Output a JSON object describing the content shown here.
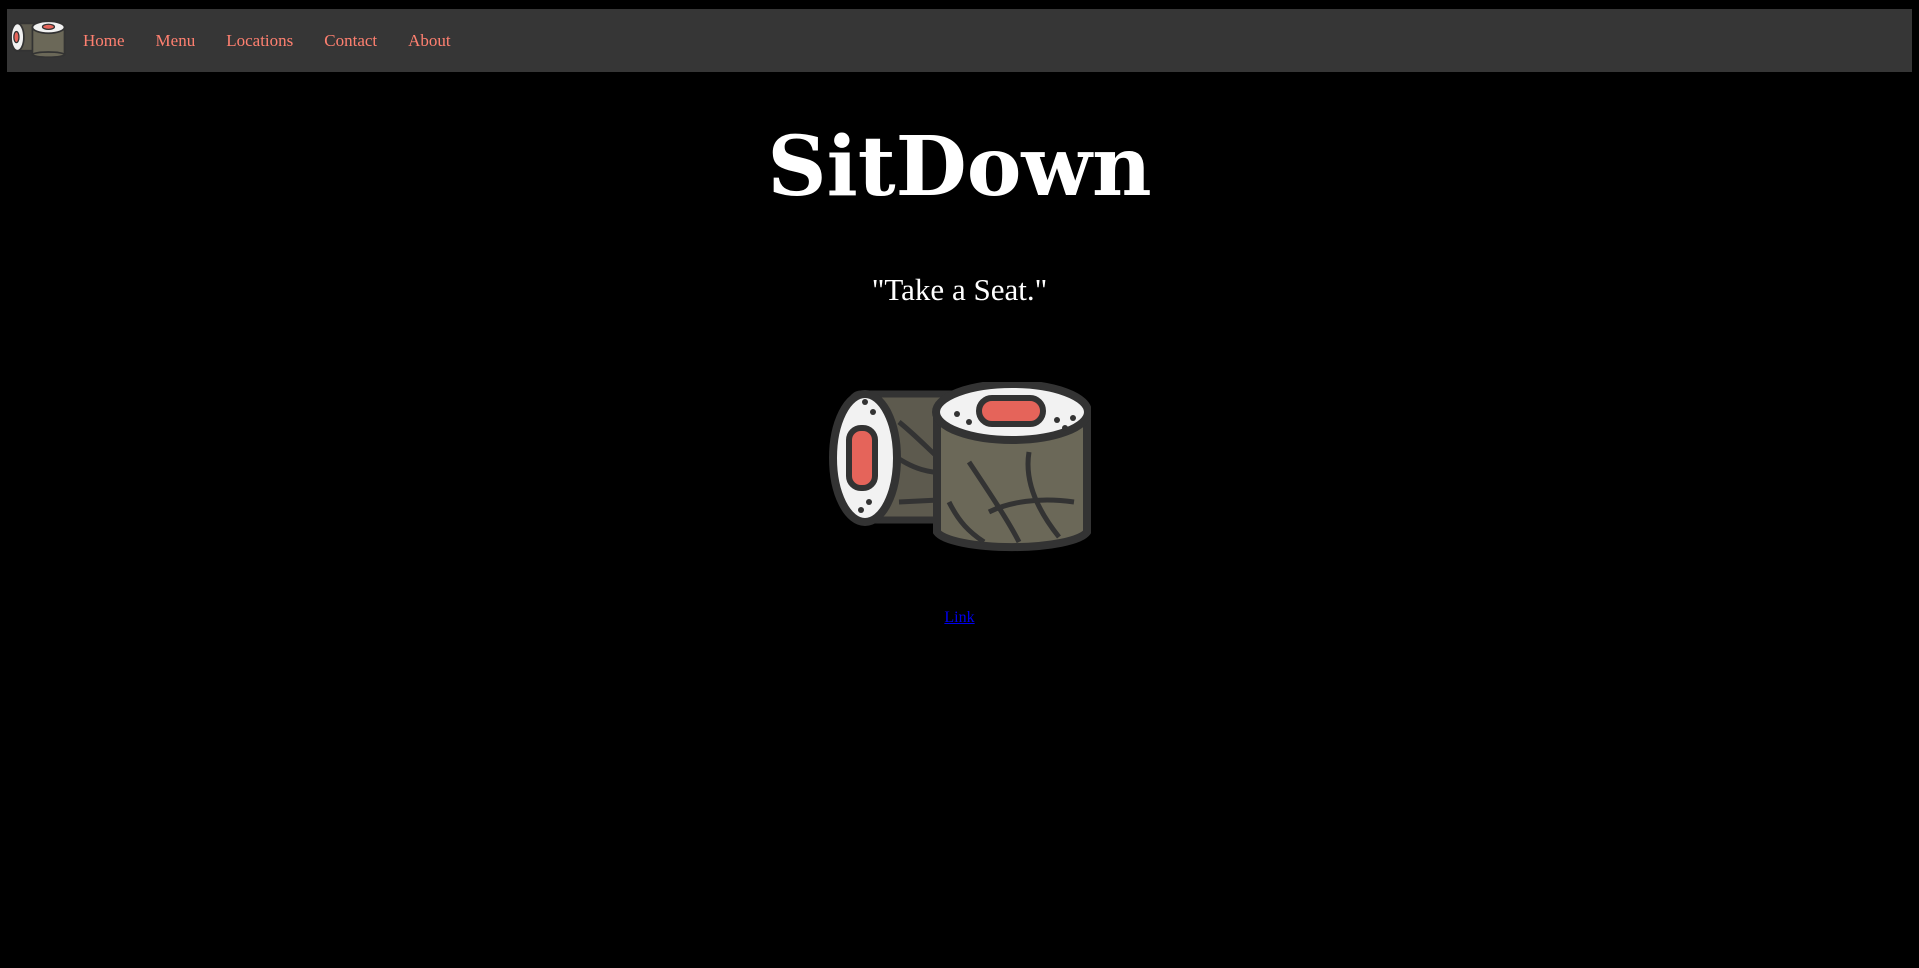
{
  "nav": {
    "logo_icon": "sushi-roll-icon",
    "items": [
      {
        "label": "Home"
      },
      {
        "label": "Menu"
      },
      {
        "label": "Locations"
      },
      {
        "label": "Contact"
      },
      {
        "label": "About"
      }
    ]
  },
  "hero": {
    "title": "SitDown",
    "tagline": "\"Take a Seat.\"",
    "image_icon": "sushi-roll-icon",
    "link_label": "Link"
  },
  "colors": {
    "background": "#000000",
    "navbar": "#363636",
    "nav_link": "#ff8070",
    "title": "#ffffff",
    "link": "#0000ee"
  }
}
